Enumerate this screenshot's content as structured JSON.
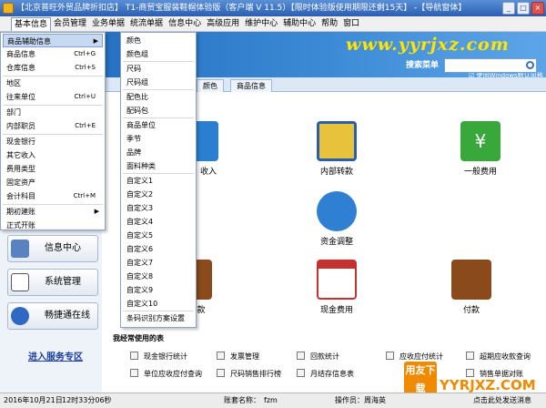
{
  "title": "【北京普旺外贸品牌折扣店】 T1-商贸宝服装鞋帽体验版（客户端 V 11.5）【限时体验版使用期限还剩15天】 -【导航窗体】",
  "menubar": [
    "基本信息",
    "会员管理",
    "业务单据",
    "统流单据",
    "信息中心",
    "高级应用",
    "维护中心",
    "辅助中心",
    "帮助",
    "窗口"
  ],
  "banner": {
    "logo": "验版",
    "watermark": "www.yyrjxz.com",
    "windows_style": "使用Windows默认风格"
  },
  "search": {
    "label": "搜索菜单",
    "value": ""
  },
  "tabs": [
    "颜色",
    "商品信息"
  ],
  "basic_menu": [
    {
      "label": "商品辅助信息",
      "shortcut": "",
      "submenu": true
    },
    {
      "label": "商品信息",
      "shortcut": "Ctrl+G"
    },
    {
      "label": "仓库信息",
      "shortcut": "Ctrl+S"
    },
    {
      "label": "地区",
      "shortcut": ""
    },
    {
      "label": "往来单位",
      "shortcut": "Ctrl+U"
    },
    {
      "label": "部门",
      "shortcut": ""
    },
    {
      "label": "内部职员",
      "shortcut": "Ctrl+E"
    },
    {
      "label": "现金银行",
      "shortcut": ""
    },
    {
      "label": "其它收入",
      "shortcut": ""
    },
    {
      "label": "费用类型",
      "shortcut": ""
    },
    {
      "label": "固定资产",
      "shortcut": ""
    },
    {
      "label": "会计科目",
      "shortcut": "Ctrl+M"
    },
    {
      "label": "期初建账",
      "shortcut": "",
      "submenu": true
    },
    {
      "label": "正式开账",
      "shortcut": ""
    }
  ],
  "aux_menu": [
    "颜色",
    "颜色组",
    "尺码",
    "尺码组",
    "配色比",
    "配码包",
    "商品单位",
    "季节",
    "品牌",
    "面料种类",
    "自定义1",
    "自定义2",
    "自定义3",
    "自定义4",
    "自定义5",
    "自定义6",
    "自定义7",
    "自定义8",
    "自定义9",
    "自定义10",
    "条码识别方案设置"
  ],
  "sidebar": {
    "info_center": "信息中心",
    "system_manage": "系统管理",
    "online": "畅捷通在线",
    "service_link": "进入服务专区"
  },
  "features": {
    "income": "收入",
    "transfer": "内部转款",
    "expense": "一般费用",
    "fund_adjust": "资金调整",
    "cash_expense": "现金费用",
    "payment": "付款",
    "partial": "款"
  },
  "frequent": {
    "title": "我经常使用的表",
    "links": [
      "现金银行统计",
      "发票管理",
      "回款统计",
      "应收应付统计",
      "超期应收款查询",
      "单位应收应付查询",
      "尺码销售排行榜",
      "月结存信息表",
      "",
      "销售单据对账"
    ]
  },
  "status": {
    "date": "2016年10月21日",
    "time": "12时33分06秒",
    "account_label": "账套名称：",
    "account": "fzm",
    "operator": "操作员：周海英",
    "hint": "点击此处发送消息"
  },
  "yy_badge": "用友下载",
  "yy_site": "YYRJXZ.COM"
}
